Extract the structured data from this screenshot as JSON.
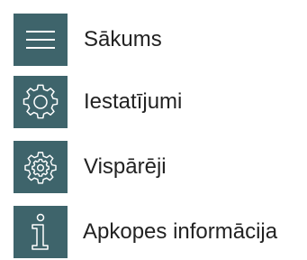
{
  "colors": {
    "tile_background": "#3e646b",
    "icon_stroke": "#ffffff",
    "label_text": "#222222"
  },
  "menu": {
    "items": [
      {
        "label": "Sākums",
        "icon": "hamburger-menu-icon"
      },
      {
        "label": "Iestatījumi",
        "icon": "gear-icon"
      },
      {
        "label": "Vispārēji",
        "icon": "general-settings-gear-icon"
      },
      {
        "label": "Apkopes informācija",
        "icon": "info-icon"
      }
    ]
  }
}
